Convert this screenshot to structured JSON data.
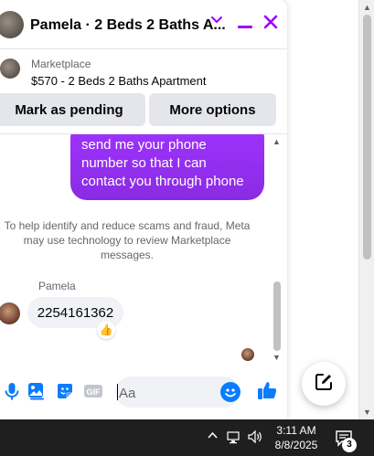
{
  "chat": {
    "title": "Pamela · 2 Beds 2 Baths A...",
    "marketplace_label": "Marketplace",
    "listing_title": "$570 - 2 Beds 2 Baths Apartment",
    "buttons": {
      "mark_pending": "Mark as pending",
      "more_options": "More options"
    },
    "messages": {
      "outgoing_text": "send me your phone number so that I can contact you through phone",
      "notice": "To help identify and reduce scams and fraud, Meta may use technology to review Marketplace messages.",
      "sender_name": "Pamela",
      "incoming_text": "2254161362"
    },
    "composer": {
      "placeholder": "Aa"
    }
  },
  "taskbar": {
    "time": "3:11 AM",
    "date": "8/8/2025",
    "notification_count": "3"
  },
  "colors": {
    "accent": "#9b00ff",
    "messenger_blue": "#0a7cff",
    "bubble_gradient_start": "#a033ff",
    "bubble_gradient_end": "#8a2be2"
  },
  "icons": [
    "chevron-down-icon",
    "minimize-icon",
    "close-icon",
    "microphone-icon",
    "photo-icon",
    "sticker-icon",
    "gif-icon",
    "emoji-icon",
    "thumbs-up-icon",
    "compose-icon",
    "network-icon",
    "volume-icon",
    "notification-icon"
  ]
}
